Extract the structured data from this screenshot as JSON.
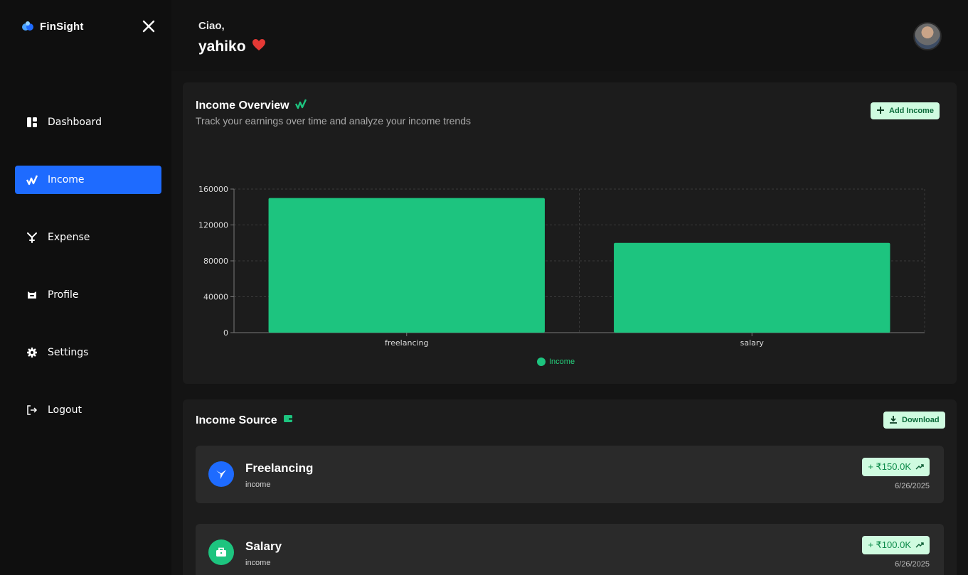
{
  "app": {
    "name": "FinSight"
  },
  "nav": [
    {
      "label": "Dashboard",
      "icon": "dashboard-icon",
      "active": false
    },
    {
      "label": "Income",
      "icon": "income-icon",
      "active": true
    },
    {
      "label": "Expense",
      "icon": "expense-icon",
      "active": false
    },
    {
      "label": "Profile",
      "icon": "profile-icon",
      "active": false
    },
    {
      "label": "Settings",
      "icon": "gear-icon",
      "active": false
    },
    {
      "label": "Logout",
      "icon": "logout-icon",
      "active": false
    }
  ],
  "header": {
    "greeting": "Ciao,",
    "username": "yahiko"
  },
  "overview": {
    "title": "Income Overview",
    "subtitle": "Track your earnings over time and analyze your income trends",
    "add_label": "Add Income"
  },
  "chart_data": {
    "type": "bar",
    "categories": [
      "freelancing",
      "salary"
    ],
    "series": [
      {
        "name": "Income",
        "values": [
          150000,
          100000
        ]
      }
    ],
    "ylim": [
      0,
      160000
    ],
    "yticks": [
      "0",
      "40000",
      "80000",
      "120000",
      "160000"
    ],
    "grid": true,
    "legend": "bottom",
    "bar_color": "#1dc47f"
  },
  "source": {
    "title": "Income Source",
    "download_label": "Download",
    "items": [
      {
        "name": "Freelancing",
        "kind": "income",
        "amount": "+ ₹150.0K",
        "date": "6/26/2025",
        "icon": "hummingbird-icon",
        "icon_color": "#1e6bff"
      },
      {
        "name": "Salary",
        "kind": "income",
        "amount": "+ ₹100.0K",
        "date": "6/26/2025",
        "icon": "briefcase-icon",
        "icon_color": "#1dc47f"
      }
    ]
  }
}
